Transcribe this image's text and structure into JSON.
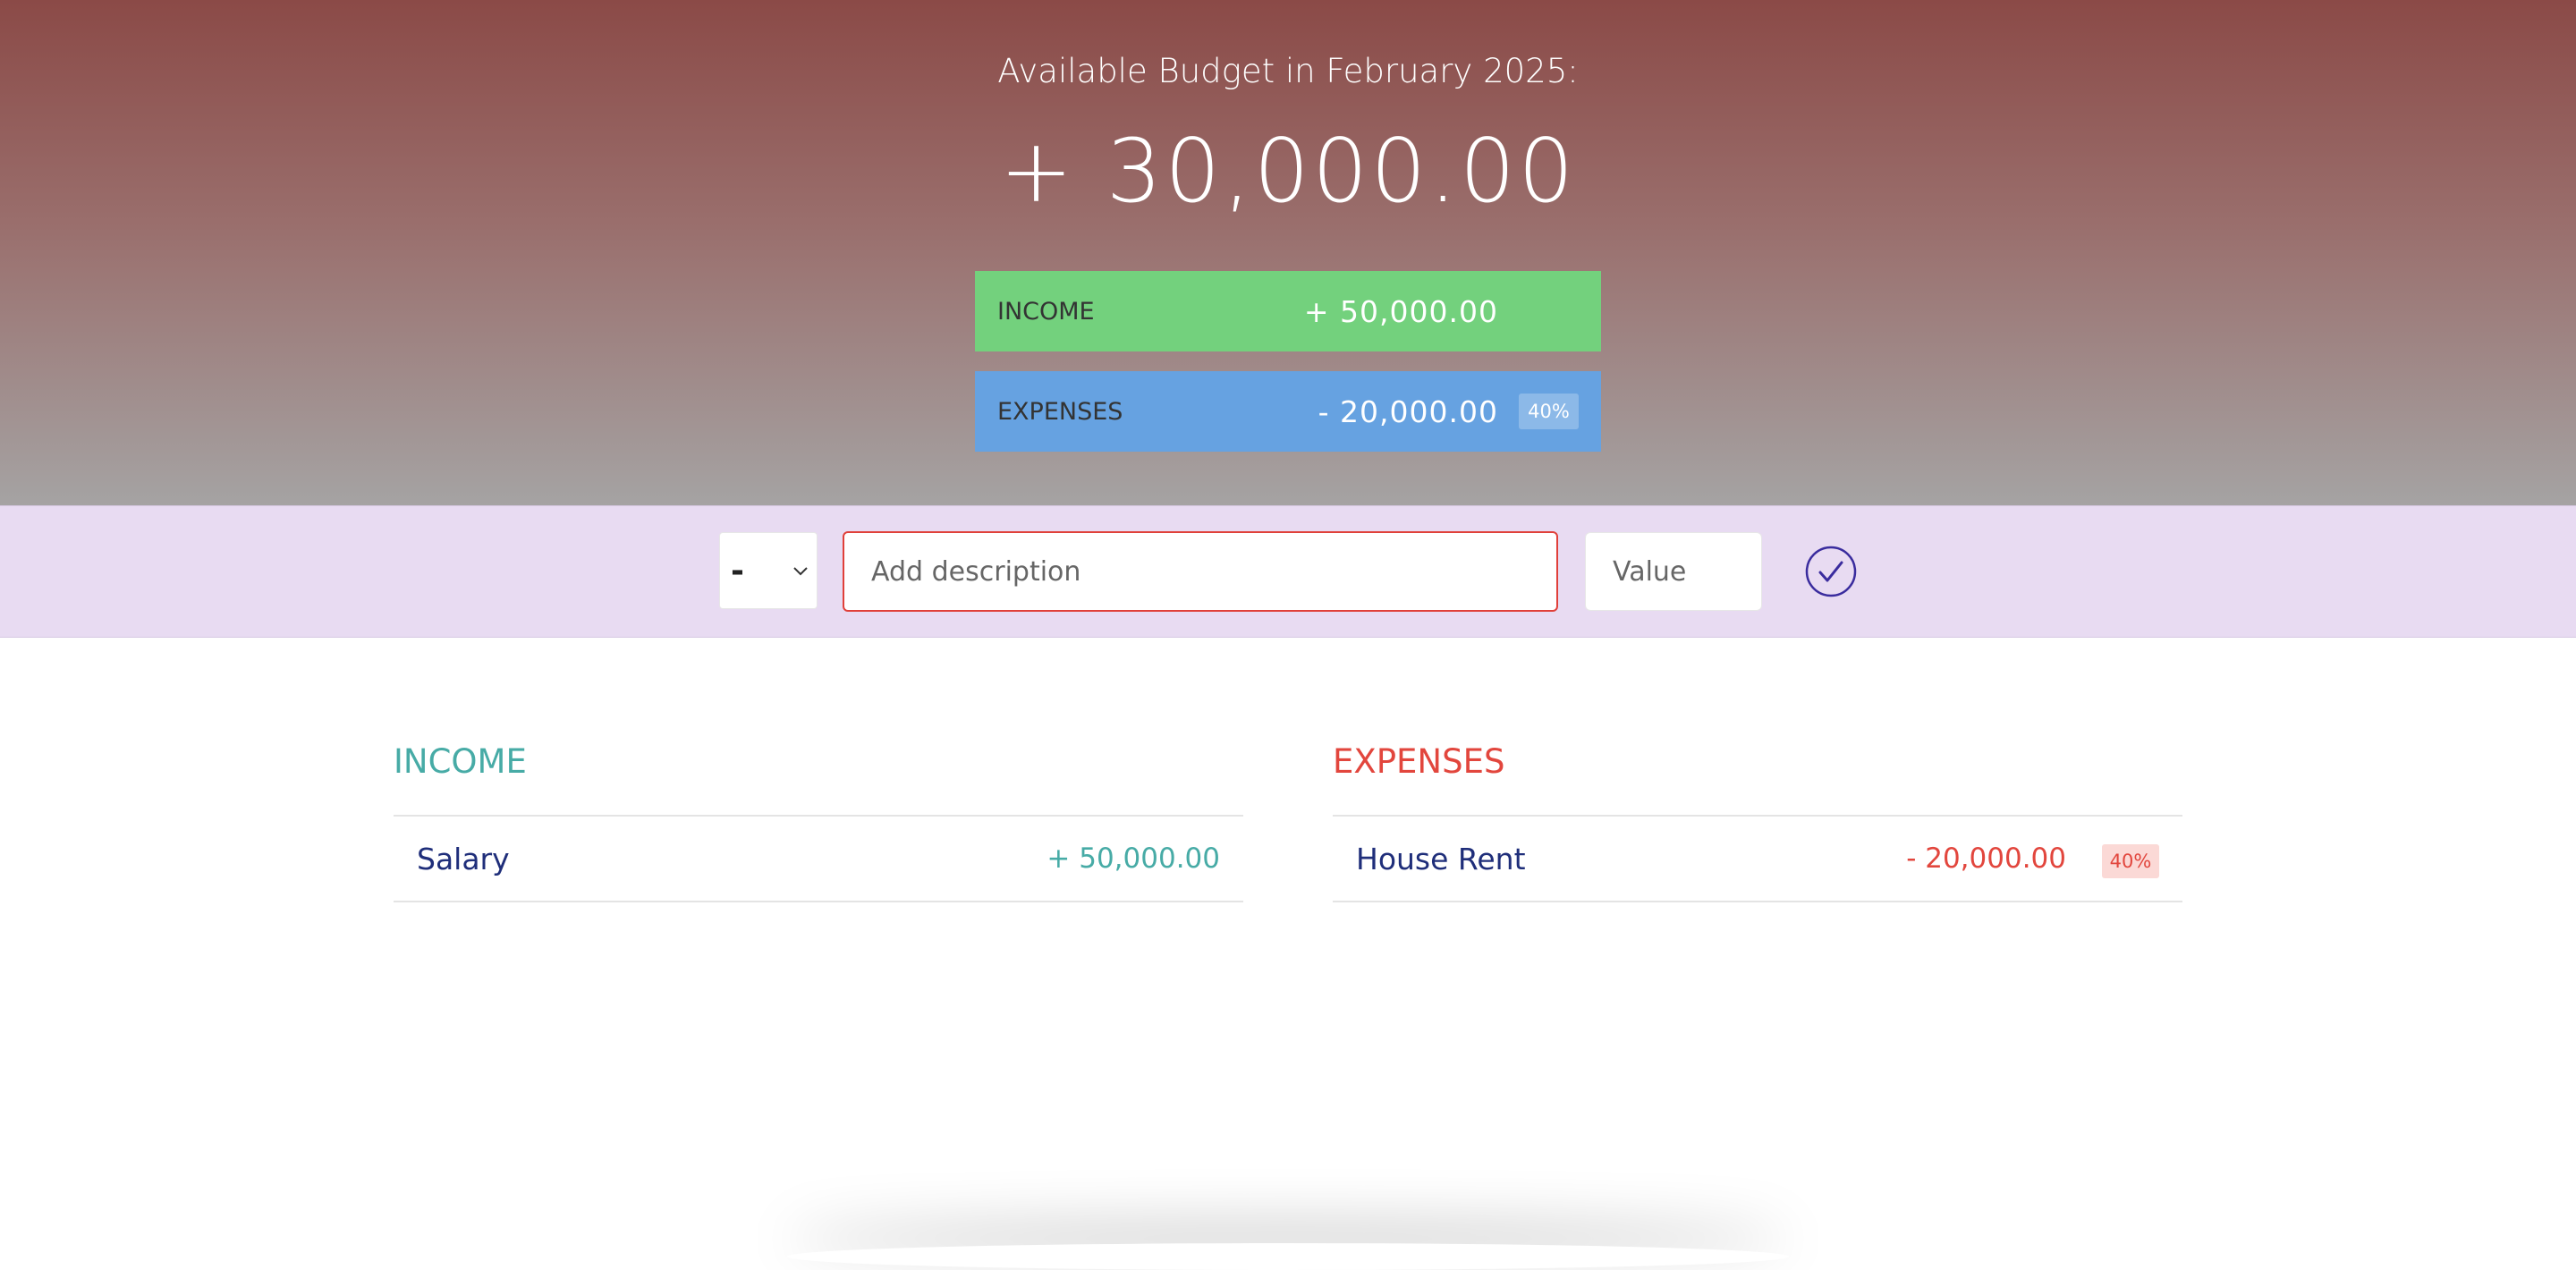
{
  "header": {
    "title": "Available Budget in February 2025:",
    "budget_value": "+ 30,000.00",
    "income": {
      "label": "INCOME",
      "value": "+ 50,000.00",
      "color": "#73d17d"
    },
    "expenses": {
      "label": "EXPENSES",
      "value": "- 20,000.00",
      "percentage": "40%",
      "color": "#66a2e1"
    }
  },
  "add_form": {
    "type_selected": "-",
    "type_options": [
      "+",
      "-"
    ],
    "description_placeholder": "Add description",
    "value_placeholder": "Value",
    "submit_icon": "check-circle-icon"
  },
  "income_list": {
    "title": "INCOME",
    "items": [
      {
        "description": "Salary",
        "value": "+ 50,000.00"
      }
    ]
  },
  "expenses_list": {
    "title": "EXPENSES",
    "items": [
      {
        "description": "House Rent",
        "value": "- 20,000.00",
        "percentage": "40%"
      }
    ]
  },
  "colors": {
    "income_accent": "#47aba6",
    "expense_accent": "#e2463d",
    "focus_border": "#e0403a",
    "button": "#3a2c9e"
  }
}
